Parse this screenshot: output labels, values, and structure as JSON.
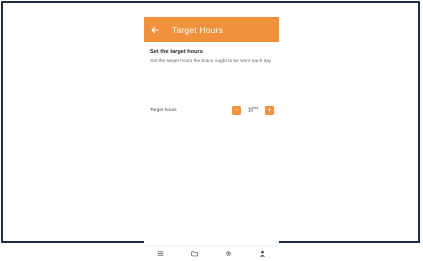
{
  "app_bar": {
    "title": "Target Hours",
    "back_icon": "arrow-left-icon"
  },
  "section": {
    "title": "Set the target hours",
    "description": "Set the target hours the brace ought to be worn each day"
  },
  "target_row": {
    "label": "Target hours",
    "decrement_label": "-",
    "value": "10",
    "unit": "hrs",
    "increment_label": "+"
  },
  "bottom_nav": {
    "items": [
      {
        "icon": "list-icon"
      },
      {
        "icon": "folder-icon"
      },
      {
        "icon": "gear-icon"
      },
      {
        "icon": "person-icon"
      }
    ]
  },
  "colors": {
    "accent": "#f2913b",
    "frame": "#1d2d4a"
  }
}
